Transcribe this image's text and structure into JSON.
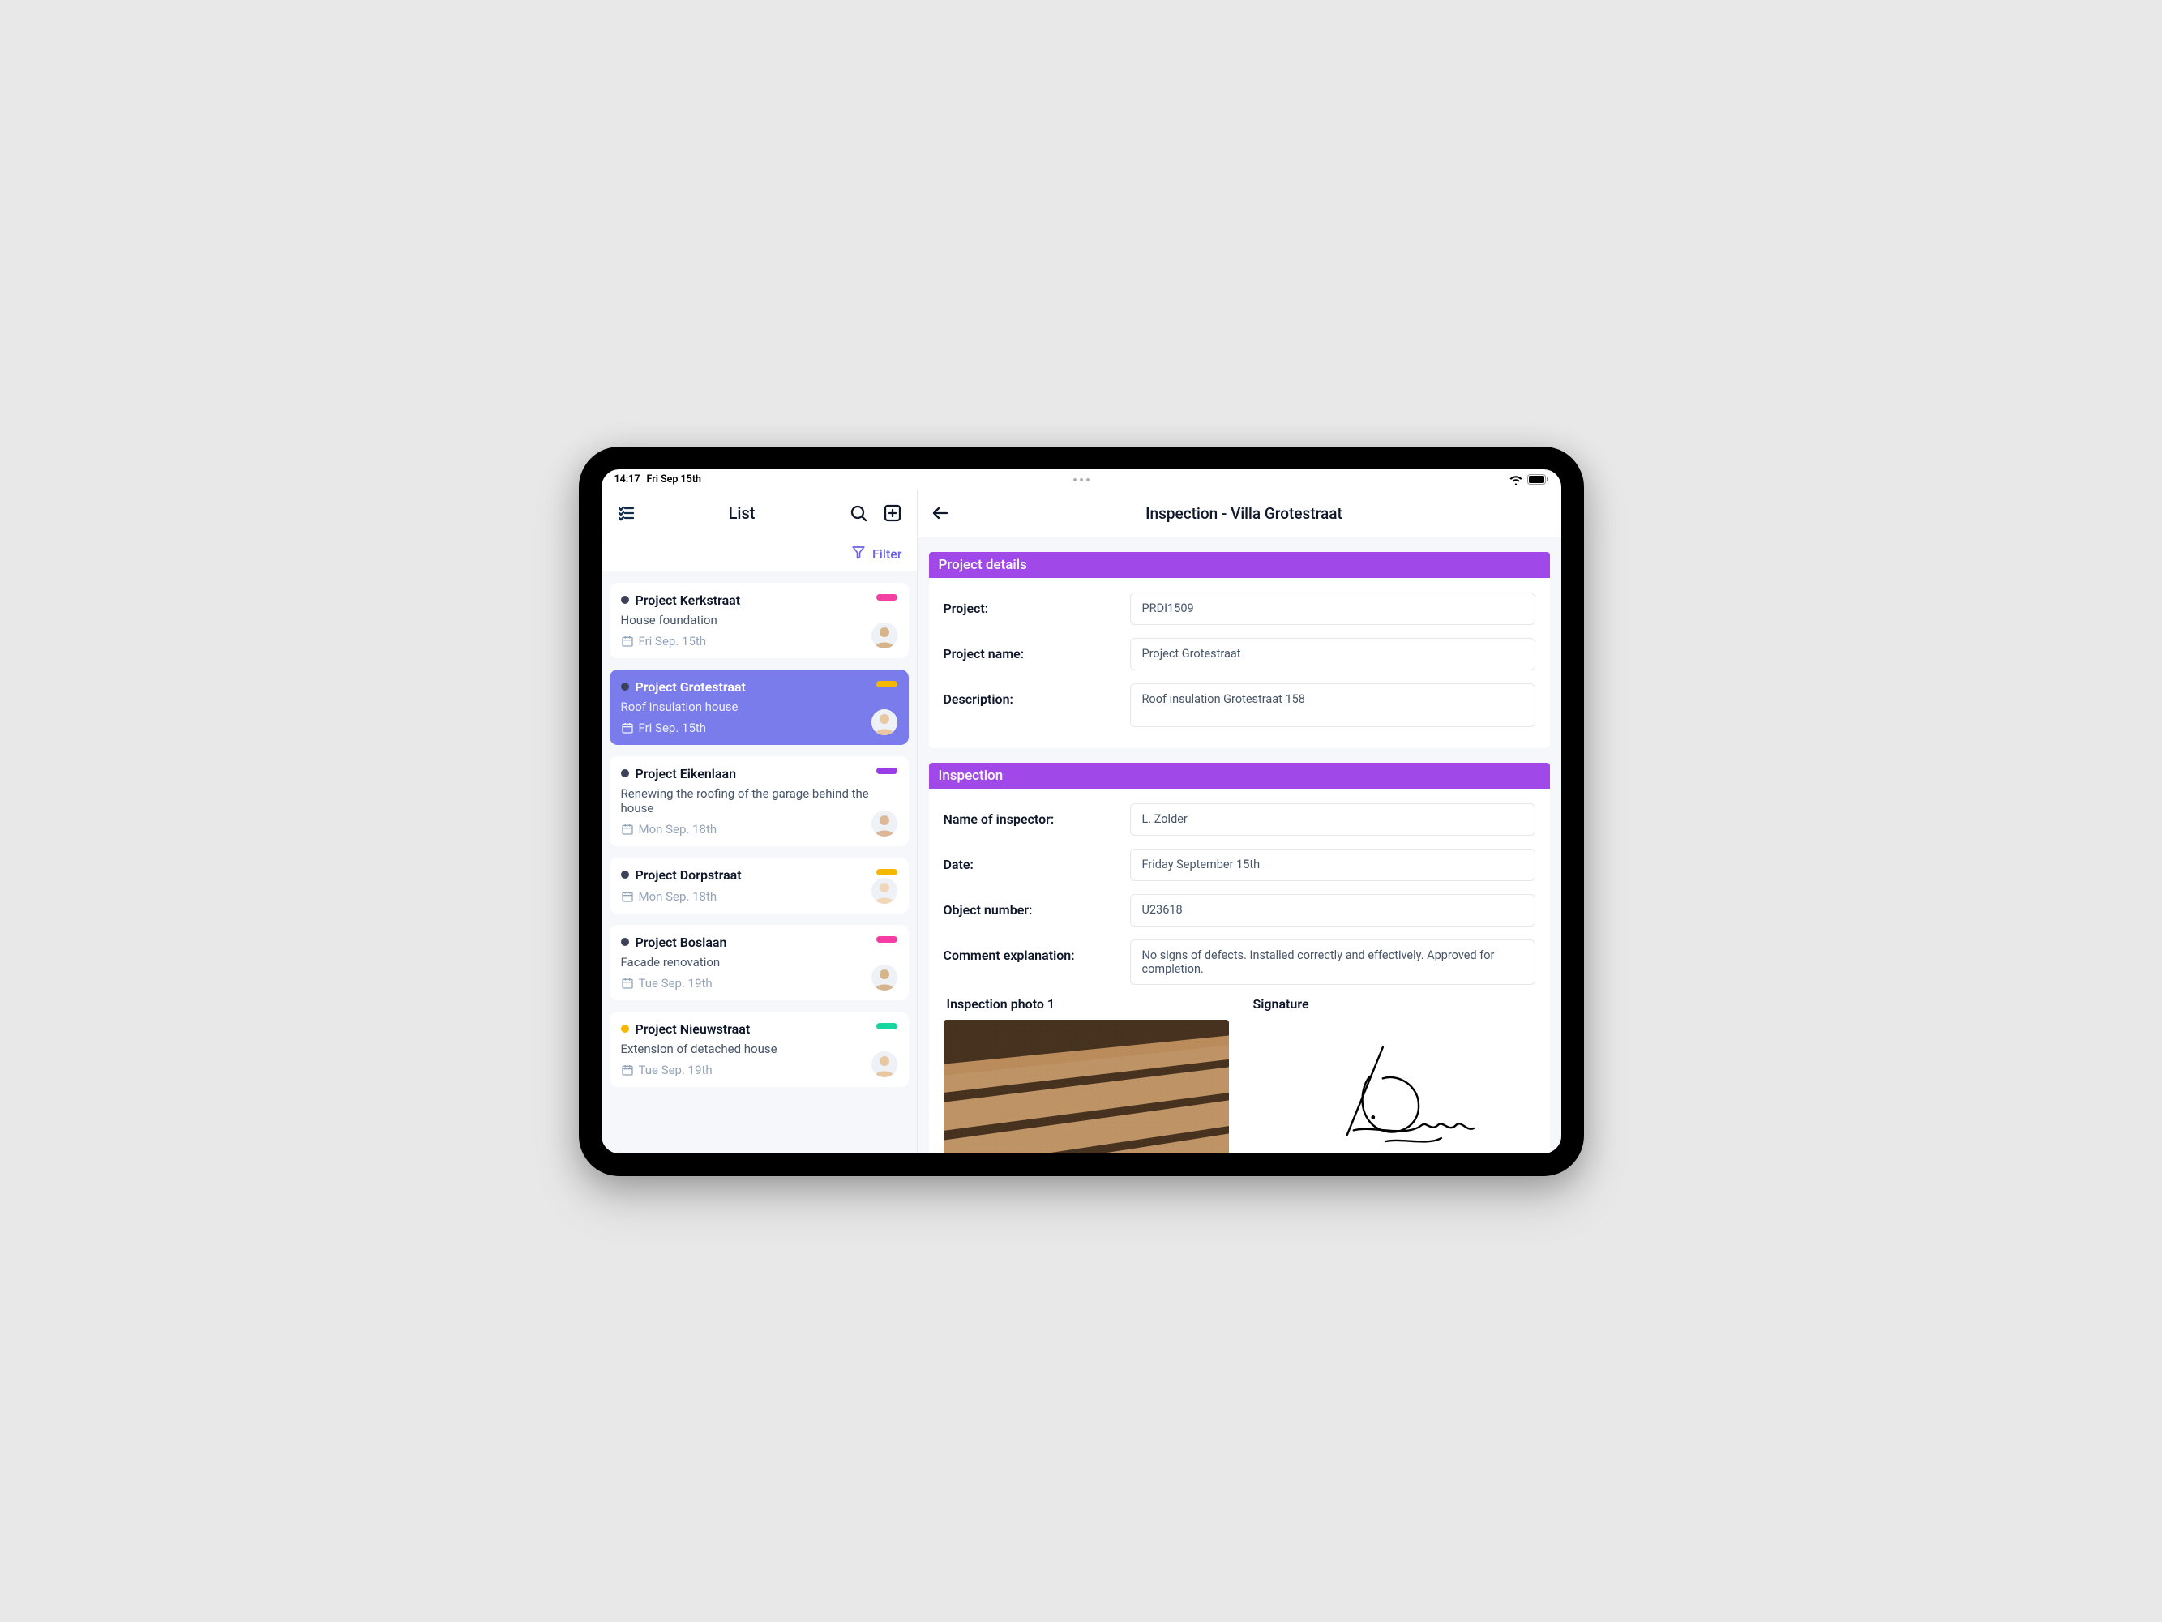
{
  "status": {
    "time": "14:17",
    "date": "Fri Sep 15th"
  },
  "leftPanel": {
    "title": "List",
    "filterLabel": "Filter",
    "items": [
      {
        "title": "Project Kerkstraat",
        "subtitle": "House foundation",
        "date": "Fri Sep. 15th",
        "dotColor": "#3b415a",
        "pillColor": "#f53ea3",
        "avatarColor": "#d6b48c",
        "selected": false
      },
      {
        "title": "Project Grotestraat",
        "subtitle": "Roof insulation house",
        "date": "Fri Sep. 15th",
        "dotColor": "#3b415a",
        "pillColor": "#f5b700",
        "avatarColor": "#e8c7a3",
        "selected": true
      },
      {
        "title": "Project Eikenlaan",
        "subtitle": "Renewing the roofing of the garage behind the house",
        "date": "Mon Sep. 18th",
        "dotColor": "#3b415a",
        "pillColor": "#9a3de9",
        "avatarColor": "#dcb898",
        "selected": false
      },
      {
        "title": "Project Dorpstraat",
        "subtitle": "",
        "date": "Mon Sep. 18th",
        "dotColor": "#3b415a",
        "pillColor": "#f5b700",
        "avatarColor": "#f0d7b8",
        "selected": false
      },
      {
        "title": "Project Boslaan",
        "subtitle": "Facade renovation",
        "date": "Tue Sep. 19th",
        "dotColor": "#3b415a",
        "pillColor": "#f53ea3",
        "avatarColor": "#d6b48c",
        "selected": false
      },
      {
        "title": "Project Nieuwstraat",
        "subtitle": "Extension of detached house",
        "date": "Tue Sep. 19th",
        "dotColor": "#f5b700",
        "pillColor": "#18d6a0",
        "avatarColor": "#e8c7a3",
        "selected": false
      }
    ]
  },
  "detail": {
    "headerTitle": "Inspection - Villa Grotestraat",
    "sections": {
      "projectDetails": {
        "header": "Project details",
        "fields": {
          "projectLabel": "Project:",
          "projectValue": "PRDI1509",
          "projectNameLabel": "Project name:",
          "projectNameValue": "Project Grotestraat",
          "descriptionLabel": "Description:",
          "descriptionValue": "Roof insulation Grotestraat 158"
        }
      },
      "inspection": {
        "header": "Inspection",
        "fields": {
          "inspectorLabel": "Name of inspector:",
          "inspectorValue": "L. Zolder",
          "dateLabel": "Date:",
          "dateValue": "Friday September 15th",
          "objectLabel": "Object number:",
          "objectValue": "U23618",
          "commentLabel": "Comment explanation:",
          "commentValue": "No signs of defects. Installed correctly and effectively. Approved for completion."
        },
        "attachments": {
          "photoLabel": "Inspection photo 1",
          "signatureLabel": "Signature"
        }
      }
    }
  }
}
